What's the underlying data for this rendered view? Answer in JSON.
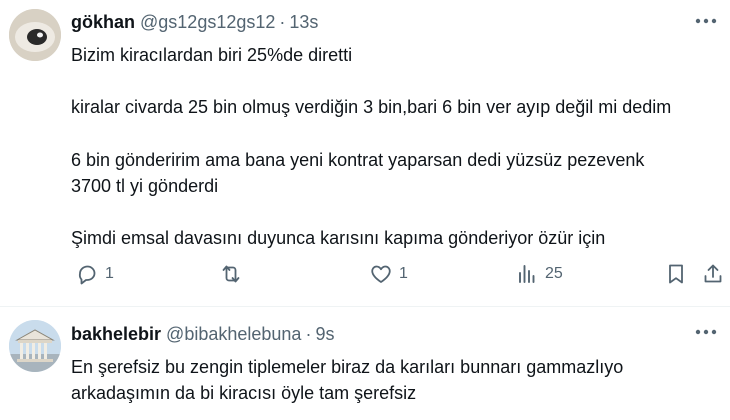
{
  "tweets": [
    {
      "name": "gökhan",
      "handle": "@gs12gs12gs12",
      "separator": "·",
      "time": "13s",
      "lines": [
        "Bizim kiracılardan biri 25%de diretti",
        "kiralar civarda 25 bin olmuş verdiğin 3 bin,bari 6 bin ver ayıp değil mi dedim",
        "6 bin gönderirim ama bana yeni kontrat yaparsan dedi yüzsüz pezevenk",
        "3700 tl yi gönderdi",
        "Şimdi emsal davasını duyunca karısını kapıma gönderiyor özür için"
      ],
      "actions": {
        "reply_count": "1",
        "like_count": "1",
        "views_count": "25"
      },
      "icons": [
        "reply-icon",
        "retweet-icon",
        "like-icon",
        "views-icon",
        "bookmark-icon",
        "share-icon",
        "more-icon"
      ]
    },
    {
      "name": "bakhelebir",
      "handle": "@bibakhelebuna",
      "separator": "·",
      "time": "9s",
      "lines": [
        "En şerefsiz bu zengin tiplemeler biraz da karıları bunnarı gammazlıyo",
        "arkadaşımın da bi kiracısı öyle tam şerefsiz"
      ],
      "icons": [
        "more-icon"
      ]
    }
  ],
  "colors": {
    "text": "#0f1419",
    "secondary": "#536471",
    "divider": "#eff3f4"
  }
}
